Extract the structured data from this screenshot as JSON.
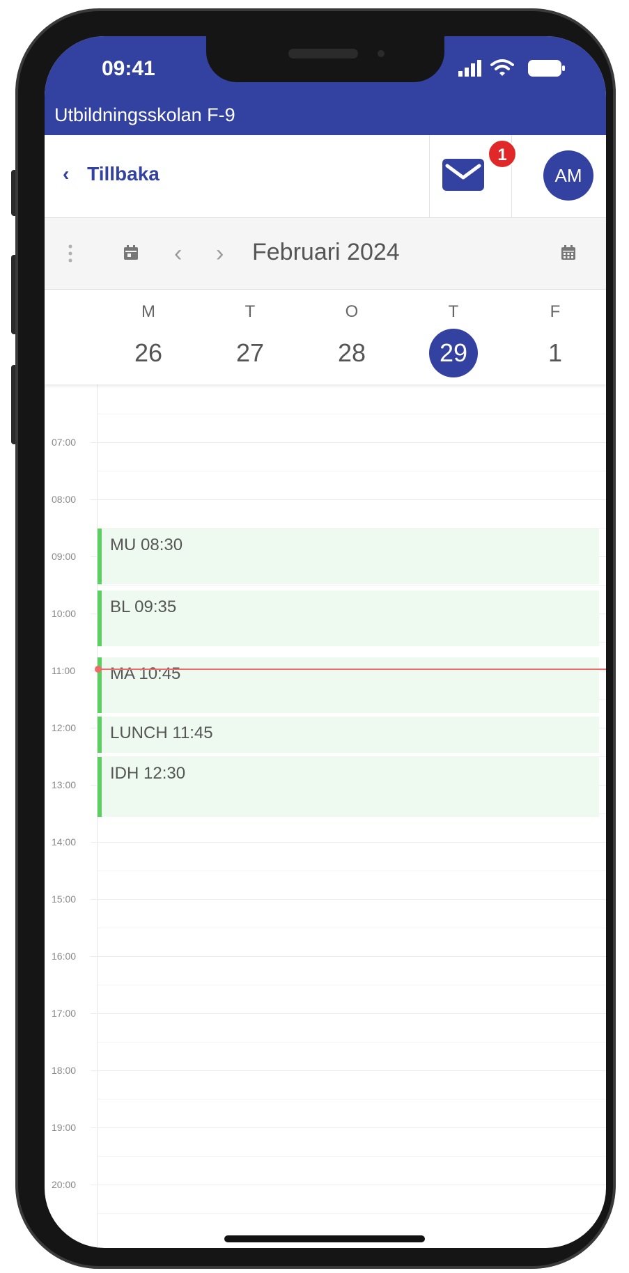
{
  "status": {
    "time": "09:41"
  },
  "app": {
    "school_name": "Utbildningsskolan F-9"
  },
  "nav": {
    "back_label": "Tillbaka",
    "mail_badge": "1",
    "avatar_initials": "AM"
  },
  "toolbar": {
    "month_label": "Februari 2024"
  },
  "days": [
    {
      "letter": "M",
      "date": "26",
      "today": false
    },
    {
      "letter": "T",
      "date": "27",
      "today": false
    },
    {
      "letter": "O",
      "date": "28",
      "today": false
    },
    {
      "letter": "T",
      "date": "29",
      "today": true
    },
    {
      "letter": "F",
      "date": "1",
      "today": false
    }
  ],
  "hours": [
    "07:00",
    "08:00",
    "09:00",
    "10:00",
    "11:00",
    "12:00",
    "13:00",
    "14:00",
    "15:00",
    "16:00",
    "17:00",
    "18:00",
    "19:00",
    "20:00"
  ],
  "events": [
    {
      "label": "MU 08:30"
    },
    {
      "label": "BL 09:35"
    },
    {
      "label": "MA 10:45"
    },
    {
      "label": "LUNCH 11:45"
    },
    {
      "label": "IDH 12:30"
    }
  ],
  "colors": {
    "brand": "#3342a0",
    "event_bg": "#eefaf0",
    "event_bar": "#5ccf62",
    "now_line": "#ef6b6b",
    "badge": "#e02828"
  }
}
